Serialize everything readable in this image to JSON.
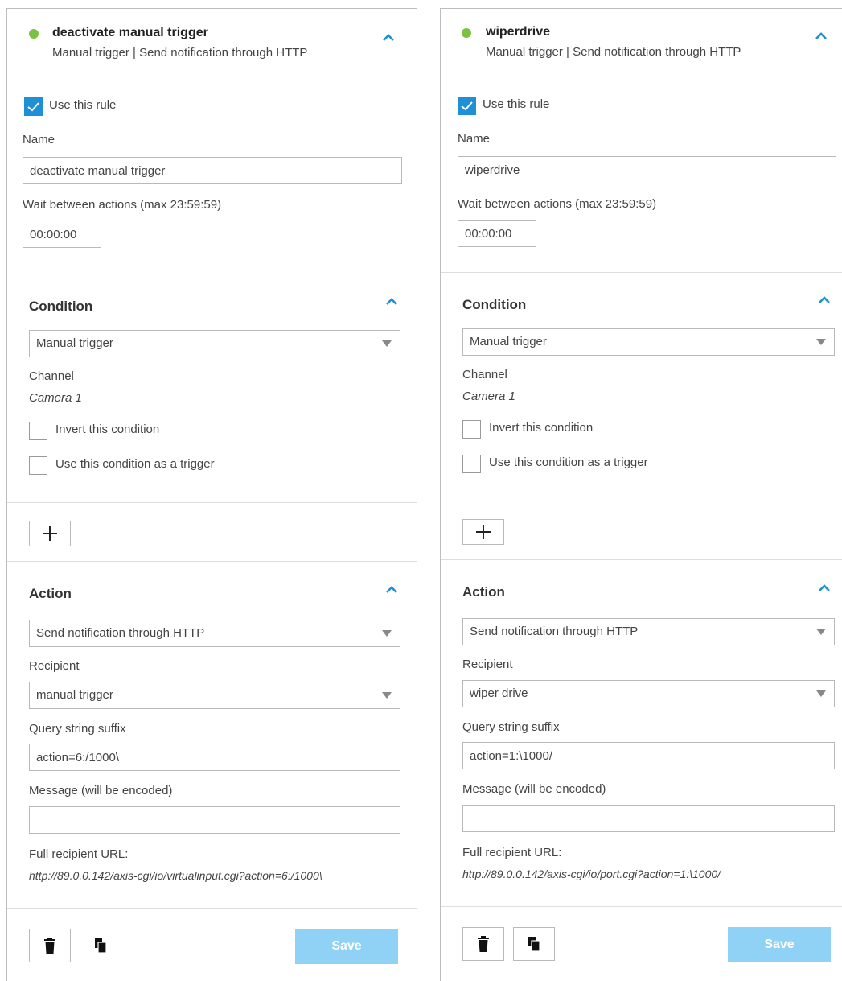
{
  "theme": {
    "accent": "#1e90d6",
    "status_active": "#7cc242",
    "save_button_bg": "#8fd2f6",
    "border": "#b9b9b9"
  },
  "rules": [
    {
      "status": "active",
      "title": "deactivate manual trigger",
      "subtitle": "Manual trigger | Send notification through HTTP",
      "use_rule_label": "Use this rule",
      "use_rule_checked": true,
      "name_label": "Name",
      "name_value": "deactivate manual trigger",
      "wait_label": "Wait between actions (max 23:59:59)",
      "wait_value": "00:00:00",
      "condition": {
        "title": "Condition",
        "selected": "Manual trigger",
        "channel_label": "Channel",
        "channel_value": "Camera 1",
        "invert_label": "Invert this condition",
        "invert_checked": false,
        "trigger_label": "Use this condition as a trigger",
        "trigger_checked": false
      },
      "add_symbol": "+",
      "action": {
        "title": "Action",
        "selected": "Send notification through HTTP",
        "recipient_label": "Recipient",
        "recipient_value": "manual trigger",
        "query_label": "Query string suffix",
        "query_value": "action=6:/1000\\",
        "message_label": "Message (will be encoded)",
        "message_value": "",
        "full_url_label": "Full recipient URL:",
        "full_url_value": "http://89.0.0.142/axis-cgi/io/virtualinput.cgi?action=6:/1000\\"
      },
      "save_label": "Save"
    },
    {
      "status": "active",
      "title": "wiperdrive",
      "subtitle": "Manual trigger | Send notification through HTTP",
      "use_rule_label": "Use this rule",
      "use_rule_checked": true,
      "name_label": "Name",
      "name_value": "wiperdrive",
      "wait_label": "Wait between actions (max 23:59:59)",
      "wait_value": "00:00:00",
      "condition": {
        "title": "Condition",
        "selected": "Manual trigger",
        "channel_label": "Channel",
        "channel_value": "Camera 1",
        "invert_label": "Invert this condition",
        "invert_checked": false,
        "trigger_label": "Use this condition as a trigger",
        "trigger_checked": false
      },
      "add_symbol": "+",
      "action": {
        "title": "Action",
        "selected": "Send notification through HTTP",
        "recipient_label": "Recipient",
        "recipient_value": "wiper drive",
        "query_label": "Query string suffix",
        "query_value": "action=1:\\1000/",
        "message_label": "Message (will be encoded)",
        "message_value": "",
        "full_url_label": "Full recipient URL:",
        "full_url_value": "http://89.0.0.142/axis-cgi/io/port.cgi?action=1:\\1000/"
      },
      "save_label": "Save"
    }
  ]
}
